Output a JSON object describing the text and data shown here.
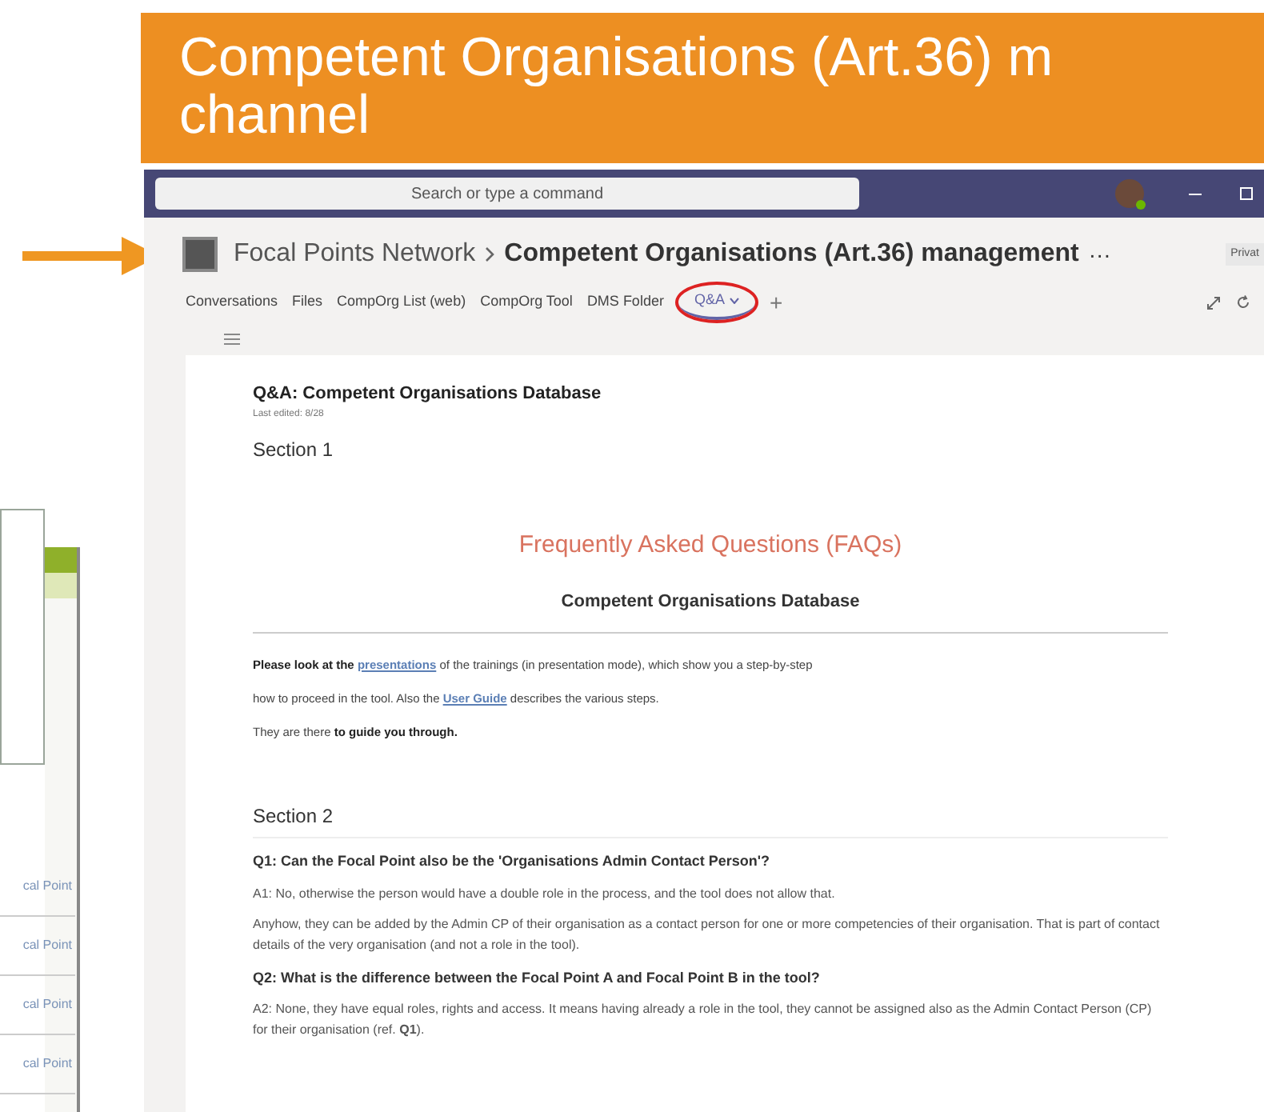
{
  "slide": {
    "title_lines": [
      "Competent Organisations (Art.36) m",
      "channel"
    ]
  },
  "side_fragment": {
    "rows": [
      "cal Point",
      "cal Point",
      "cal Point",
      "cal Point"
    ]
  },
  "teams": {
    "search": {
      "placeholder": "Search or type a command"
    },
    "team": "Focal Points Network",
    "channel": "Competent Organisations (Art.36) management",
    "more": "···",
    "badge": "Privat",
    "tabs": [
      {
        "label": "Conversations",
        "selected": false,
        "highlighted": false
      },
      {
        "label": "Files",
        "selected": false,
        "highlighted": false
      },
      {
        "label": "CompOrg List (web)",
        "selected": false,
        "highlighted": false
      },
      {
        "label": "CompOrg Tool",
        "selected": false,
        "highlighted": false
      },
      {
        "label": "DMS Folder",
        "selected": false,
        "highlighted": false
      },
      {
        "label": "Q&A",
        "selected": true,
        "highlighted": true
      }
    ],
    "add_tab": "+",
    "page": {
      "title": "Q&A: Competent Organisations Database",
      "last_edited": "Last edited: 8/28",
      "section_1": "Section 1",
      "faq_heading": "Frequently Asked Questions (FAQs)",
      "subheading": "Competent Organisations Database",
      "intro": [
        [
          {
            "kind": "bold",
            "text": "Please look at the "
          },
          {
            "kind": "link",
            "text": "presentations"
          },
          {
            "kind": "plain",
            "text": " of the trainings (in presentation mode), which show you a step-by-step"
          }
        ],
        [
          {
            "kind": "plain",
            "text": "how to proceed in the tool. Also the "
          },
          {
            "kind": "link",
            "text": "User Guide"
          },
          {
            "kind": "plain",
            "text": " describes the various steps."
          }
        ],
        [
          {
            "kind": "plain",
            "text": "They are there "
          },
          {
            "kind": "bold",
            "text": "to guide you through."
          }
        ]
      ],
      "section_2": "Section 2",
      "faq": [
        {
          "question": "Q1: Can the Focal Point also be the 'Organisations Admin Contact Person'?",
          "answers": [
            "A1: No, otherwise the person would have a double role in the process, and the tool does not allow that.",
            "Anyhow, they can be added by the Admin CP of their organisation as a contact person for one or more competencies of their organisation. That is part of contact details of the very organisation (and not a role in the tool)."
          ]
        },
        {
          "question": "Q2: What is the difference between the Focal Point A and Focal Point B in the tool?",
          "answers": [
            "A2: None, they have equal roles, rights and access. It means having already a role in the tool, they cannot be assigned also as the Admin Contact Person (CP) for their organisation (ref. **Q1**)."
          ]
        }
      ]
    }
  }
}
